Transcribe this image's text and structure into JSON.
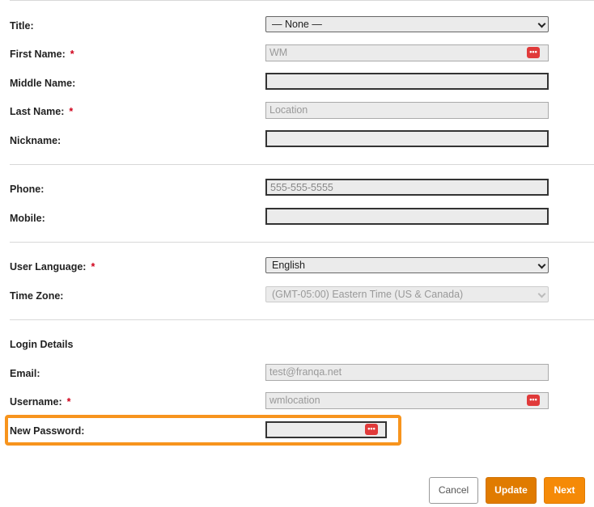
{
  "form": {
    "title": {
      "label": "Title:",
      "value": "— None —"
    },
    "first_name": {
      "label": "First Name:",
      "required": "*",
      "value": "WM"
    },
    "middle_name": {
      "label": "Middle Name:",
      "value": ""
    },
    "last_name": {
      "label": "Last Name:",
      "required": "*",
      "value": "Location"
    },
    "nickname": {
      "label": "Nickname:",
      "value": ""
    },
    "phone": {
      "label": "Phone:",
      "placeholder": "555-555-5555"
    },
    "mobile": {
      "label": "Mobile:",
      "value": ""
    },
    "user_language": {
      "label": "User Language:",
      "required": "*",
      "value": "English"
    },
    "time_zone": {
      "label": "Time Zone:",
      "value": "(GMT-05:00) Eastern Time (US & Canada)"
    },
    "login_details": {
      "heading": "Login Details"
    },
    "email": {
      "label": "Email:",
      "value": "test@franqa.net"
    },
    "username": {
      "label": "Username:",
      "required": "*",
      "value": "wmlocation"
    },
    "new_password": {
      "label": "New Password:",
      "value": ""
    }
  },
  "buttons": {
    "cancel": "Cancel",
    "update": "Update",
    "next": "Next"
  },
  "icons": {
    "password_manager": "password-manager-icon",
    "dropdown": "chevron-down-icon"
  },
  "colors": {
    "required": "#d0021b",
    "highlight": "#f7941d",
    "primary_button": "#e07b00",
    "next_button": "#f58a07",
    "password_icon": "#e03a3a"
  }
}
